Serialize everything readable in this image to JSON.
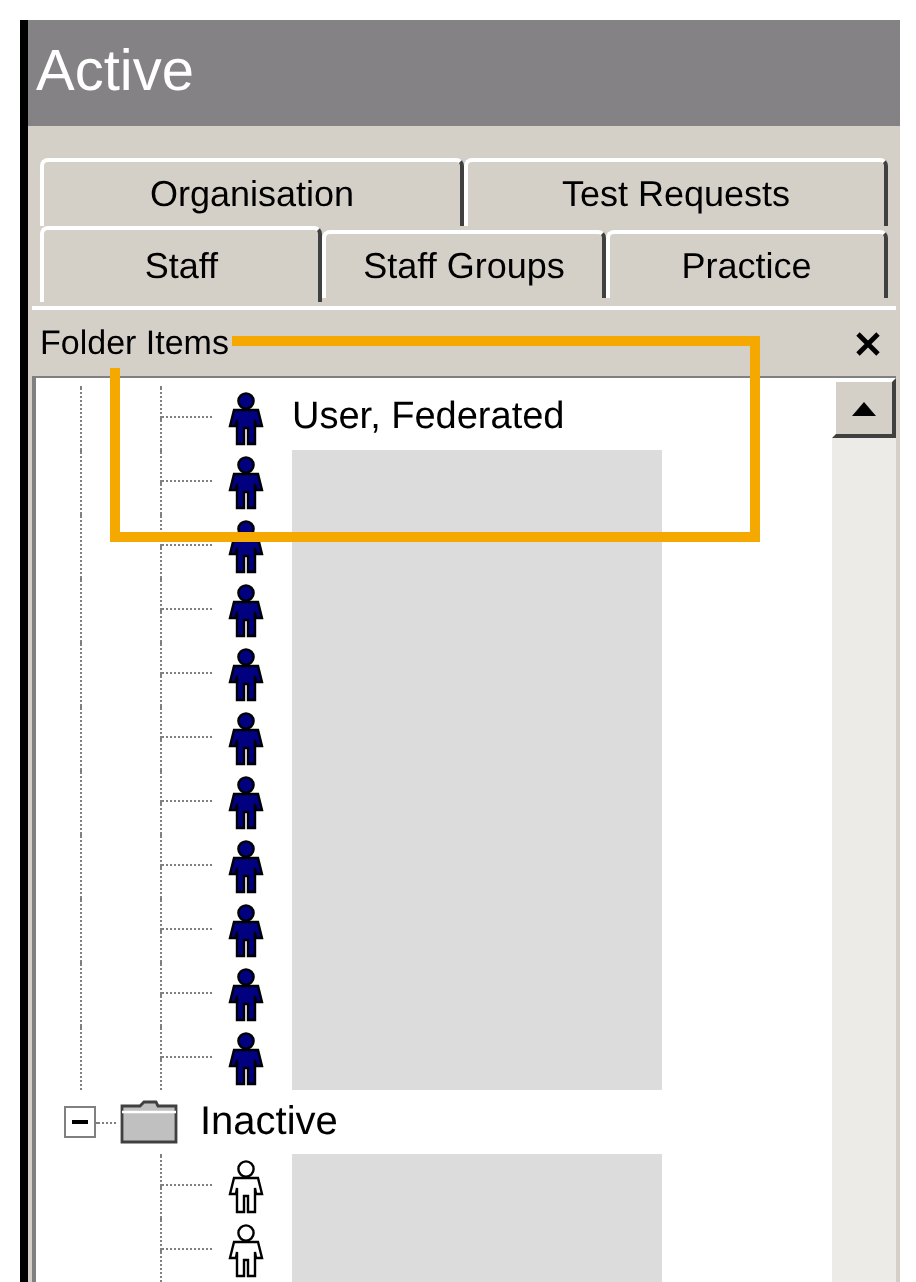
{
  "header": {
    "title": "Active"
  },
  "tab_rows": [
    {
      "tabs": [
        {
          "label": "Organisation",
          "selected": false
        },
        {
          "label": "Test Requests",
          "selected": false
        }
      ]
    },
    {
      "tabs": [
        {
          "label": "Staff",
          "selected": true
        },
        {
          "label": "Staff Groups",
          "selected": false
        },
        {
          "label": "Practice",
          "selected": false
        }
      ]
    }
  ],
  "panel": {
    "title": "Folder Items"
  },
  "tree": [
    {
      "kind": "folder",
      "children": [
        {
          "kind": "user",
          "active": true,
          "name": "User, Federated"
        },
        {
          "kind": "user",
          "active": true,
          "redacted": true
        },
        {
          "kind": "user",
          "active": true,
          "redacted": true
        },
        {
          "kind": "user",
          "active": true,
          "redacted": true
        },
        {
          "kind": "user",
          "active": true,
          "redacted": true
        },
        {
          "kind": "user",
          "active": true,
          "redacted": true
        },
        {
          "kind": "user",
          "active": true,
          "redacted": true
        },
        {
          "kind": "user",
          "active": true,
          "redacted": true
        },
        {
          "kind": "user",
          "active": true,
          "redacted": true
        },
        {
          "kind": "user",
          "active": true,
          "redacted": true
        },
        {
          "kind": "user",
          "active": true,
          "redacted": true
        }
      ]
    },
    {
      "kind": "folder",
      "label": "Inactive",
      "expanded": true,
      "children": [
        {
          "kind": "user",
          "active": false,
          "redacted": true
        },
        {
          "kind": "user",
          "active": false,
          "redacted": true
        }
      ]
    }
  ]
}
